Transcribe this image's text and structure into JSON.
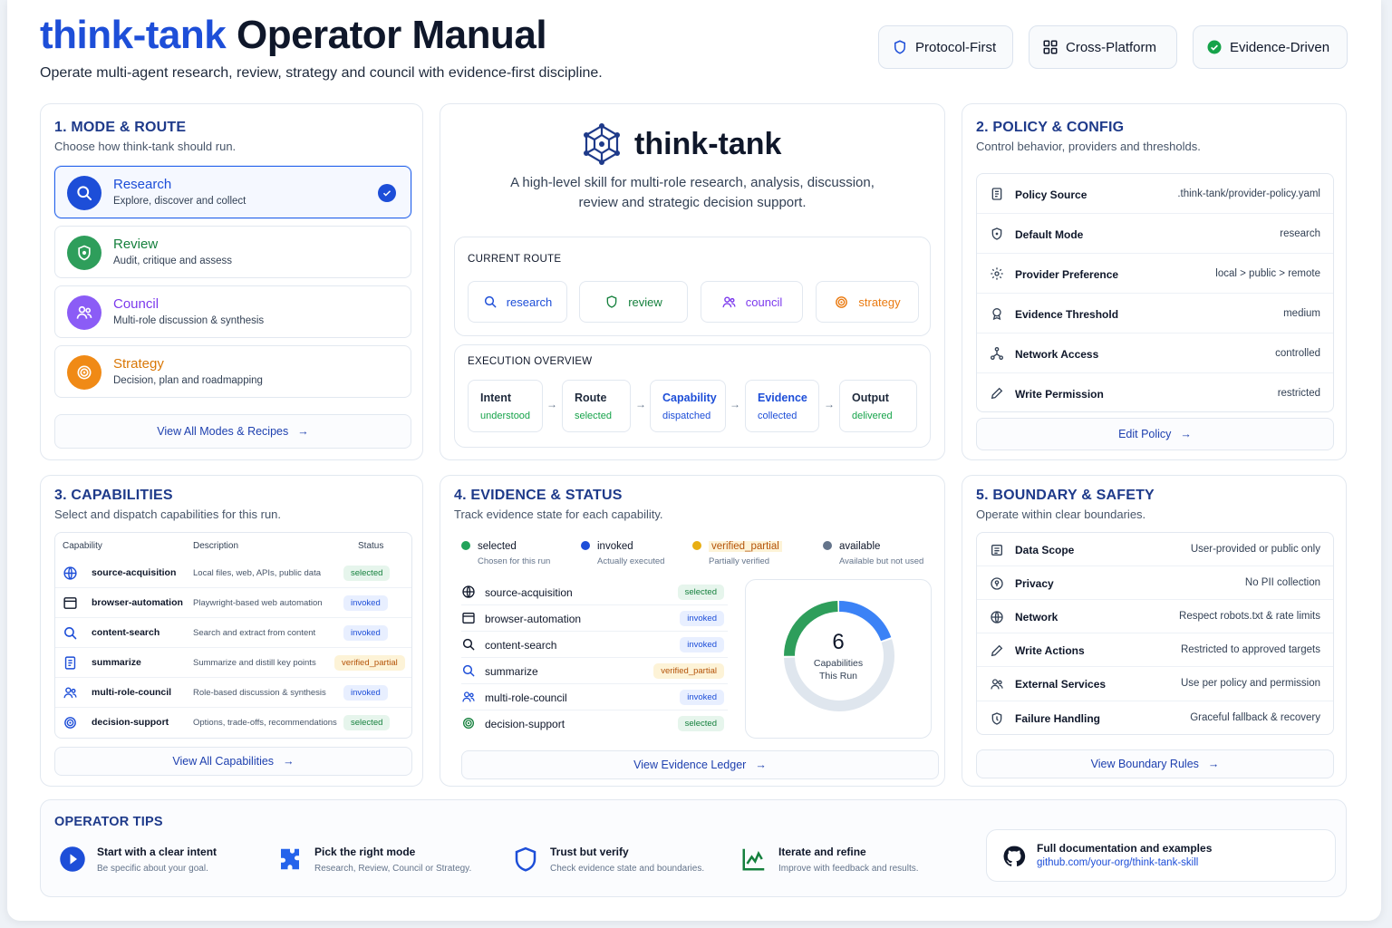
{
  "header": {
    "title_brand": "think-tank",
    "title_rest": "Operator Manual",
    "subtitle": "Operate multi-agent research, review, strategy and council with evidence-first discipline.",
    "pills": [
      {
        "label": "Protocol-First",
        "icon": "shield-icon"
      },
      {
        "label": "Cross-Platform",
        "icon": "grid-icon"
      },
      {
        "label": "Evidence-Driven",
        "icon": "check-circle-icon"
      }
    ]
  },
  "modes": {
    "title": "1.  MODE & ROUTE",
    "subtitle": "Choose how think-tank should run.",
    "items": [
      {
        "name": "Research",
        "desc": "Explore, discover and collect",
        "icon": "search-icon",
        "color": "#1d4ed8",
        "selected": true
      },
      {
        "name": "Review",
        "desc": "Audit, critique and assess",
        "icon": "shield-icon",
        "color": "#15803d"
      },
      {
        "name": "Council",
        "desc": "Multi-role discussion & synthesis",
        "icon": "users-icon",
        "color": "#7c3aed"
      },
      {
        "name": "Strategy",
        "desc": "Decision, plan and roadmapping",
        "icon": "target-icon",
        "color": "#ea7a10"
      }
    ],
    "link": "View All Modes & Recipes"
  },
  "center": {
    "brand": "think-tank",
    "tagline_1": "A high-level skill for multi-role research, analysis, discussion,",
    "tagline_2": "review and strategic decision support.",
    "route_label": "CURRENT ROUTE",
    "routes": [
      {
        "label": "research",
        "icon": "search-icon",
        "color": "#1d4ed8"
      },
      {
        "label": "review",
        "icon": "shield-icon",
        "color": "#15803d"
      },
      {
        "label": "council",
        "icon": "users-icon",
        "color": "#7c3aed"
      },
      {
        "label": "strategy",
        "icon": "target-icon",
        "color": "#ea7a10"
      }
    ],
    "exec_label": "EXECUTION OVERVIEW",
    "steps": [
      {
        "title": "Intent",
        "status": "understood",
        "color": "#0f172a"
      },
      {
        "title": "Route",
        "status": "selected",
        "color": "#0f172a"
      },
      {
        "title": "Capability",
        "status": "dispatched",
        "color": "#1d4ed8"
      },
      {
        "title": "Evidence",
        "status": "collected",
        "color": "#1d4ed8"
      },
      {
        "title": "Output",
        "status": "delivered",
        "color": "#0f172a"
      }
    ]
  },
  "policy": {
    "title": "2.  POLICY & CONFIG",
    "subtitle": "Control behavior, providers and thresholds.",
    "rows": [
      {
        "label": "Policy Source",
        "value": ".think-tank/provider-policy.yaml",
        "icon": "file-icon"
      },
      {
        "label": "Default Mode",
        "value": "research",
        "icon": "shield-icon"
      },
      {
        "label": "Provider Preference",
        "value": "local > public > remote",
        "icon": "gear-icon"
      },
      {
        "label": "Evidence Threshold",
        "value": "medium",
        "icon": "badge-icon"
      },
      {
        "label": "Network Access",
        "value": "controlled",
        "icon": "network-icon"
      },
      {
        "label": "Write Permission",
        "value": "restricted",
        "icon": "pencil-icon"
      }
    ],
    "link": "Edit Policy"
  },
  "capabilities": {
    "title": "3.  CAPABILITIES",
    "subtitle": "Select and dispatch capabilities for this run.",
    "headers": [
      "Capability",
      "Description",
      "Status"
    ],
    "rows": [
      {
        "name": "source-acquisition",
        "desc": "Local files, web, APIs, public data",
        "status": "selected",
        "icon": "globe-icon"
      },
      {
        "name": "browser-automation",
        "desc": "Playwright-based web automation",
        "status": "invoked",
        "icon": "browser-icon"
      },
      {
        "name": "content-search",
        "desc": "Search and extract from content",
        "status": "invoked",
        "icon": "search-icon"
      },
      {
        "name": "summarize",
        "desc": "Summarize and distill key points",
        "status": "verified_partial",
        "icon": "doc-icon"
      },
      {
        "name": "multi-role-council",
        "desc": "Role-based discussion & synthesis",
        "status": "invoked",
        "icon": "users-icon"
      },
      {
        "name": "decision-support",
        "desc": "Options, trade-offs, recommendations",
        "status": "selected",
        "icon": "target-icon"
      }
    ],
    "link": "View All Capabilities"
  },
  "evidence": {
    "title": "4.  EVIDENCE & STATUS",
    "subtitle": "Track evidence state for each capability.",
    "legend": [
      {
        "name": "selected",
        "sub": "Chosen for this run",
        "color": "#22a35a"
      },
      {
        "name": "invoked",
        "sub": "Actually executed",
        "color": "#1d4ed8"
      },
      {
        "name": "verified_partial",
        "sub": "Partially verified",
        "color": "#e8ae12"
      },
      {
        "name": "available",
        "sub": "Available but not used",
        "color": "#64748b"
      }
    ],
    "rows": [
      {
        "name": "source-acquisition",
        "status": "selected",
        "icon": "globe-icon"
      },
      {
        "name": "browser-automation",
        "status": "invoked",
        "icon": "browser-icon"
      },
      {
        "name": "content-search",
        "status": "invoked",
        "icon": "search-icon"
      },
      {
        "name": "summarize",
        "status": "verified_partial",
        "icon": "search-icon"
      },
      {
        "name": "multi-role-council",
        "status": "invoked",
        "icon": "users-icon"
      },
      {
        "name": "decision-support",
        "status": "selected",
        "icon": "target-icon"
      }
    ],
    "donut": {
      "count": "6",
      "label_1": "Capabilities",
      "label_2": "This Run",
      "segments": [
        {
          "name": "invoked",
          "fraction": 0.2,
          "color": "#3b82f6"
        },
        {
          "name": "remaining",
          "fraction": 0.55,
          "color": "#dfe6ee"
        },
        {
          "name": "selected",
          "fraction": 0.25,
          "color": "#2e9e5b"
        }
      ]
    },
    "link": "View Evidence Ledger"
  },
  "boundary": {
    "title": "5.  BOUNDARY & SAFETY",
    "subtitle": "Operate within clear boundaries.",
    "rows": [
      {
        "label": "Data Scope",
        "value": "User-provided or public only",
        "icon": "file-icon"
      },
      {
        "label": "Privacy",
        "value": "No PII collection",
        "icon": "privacy-icon"
      },
      {
        "label": "Network",
        "value": "Respect robots.txt & rate limits",
        "icon": "globe-icon"
      },
      {
        "label": "Write Actions",
        "value": "Restricted to approved targets",
        "icon": "pencil-icon"
      },
      {
        "label": "External Services",
        "value": "Use per policy and permission",
        "icon": "users-icon"
      },
      {
        "label": "Failure Handling",
        "value": "Graceful fallback & recovery",
        "icon": "shield-icon"
      }
    ],
    "link": "View Boundary Rules"
  },
  "tips": {
    "title": "OPERATOR TIPS",
    "items": [
      {
        "title": "Start with a clear intent",
        "sub": "Be specific about your goal.",
        "icon": "play-icon"
      },
      {
        "title": "Pick the right mode",
        "sub": "Research, Review, Council or Strategy.",
        "icon": "puzzle-icon"
      },
      {
        "title": "Trust but verify",
        "sub": "Check evidence state and boundaries.",
        "icon": "shield-icon"
      },
      {
        "title": "Iterate and refine",
        "sub": "Improve with feedback and results.",
        "icon": "chart-icon"
      }
    ],
    "docs_title": "Full documentation and examples",
    "docs_link": "github.com/your-org/think-tank-skill"
  }
}
